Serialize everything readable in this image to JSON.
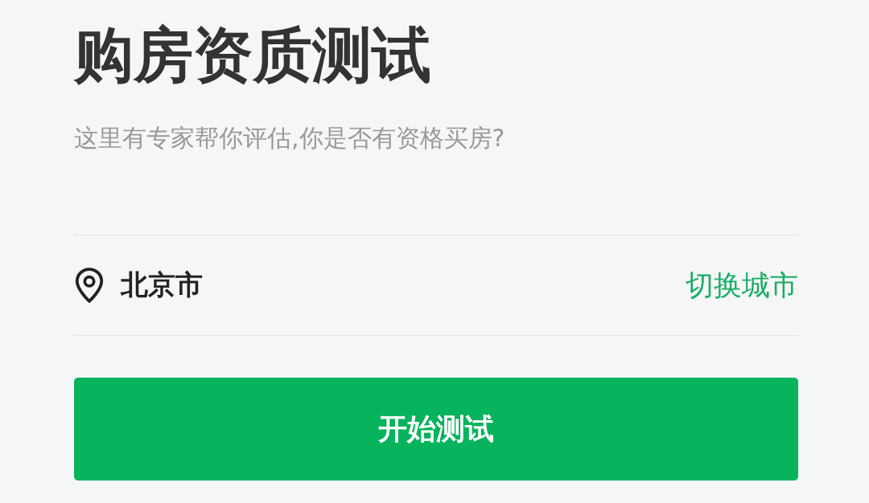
{
  "title": "购房资质测试",
  "subtitle": "这里有专家帮你评估,你是否有资格买房?",
  "location": {
    "city": "北京市",
    "switch_link": "切换城市"
  },
  "start_button": "开始测试"
}
